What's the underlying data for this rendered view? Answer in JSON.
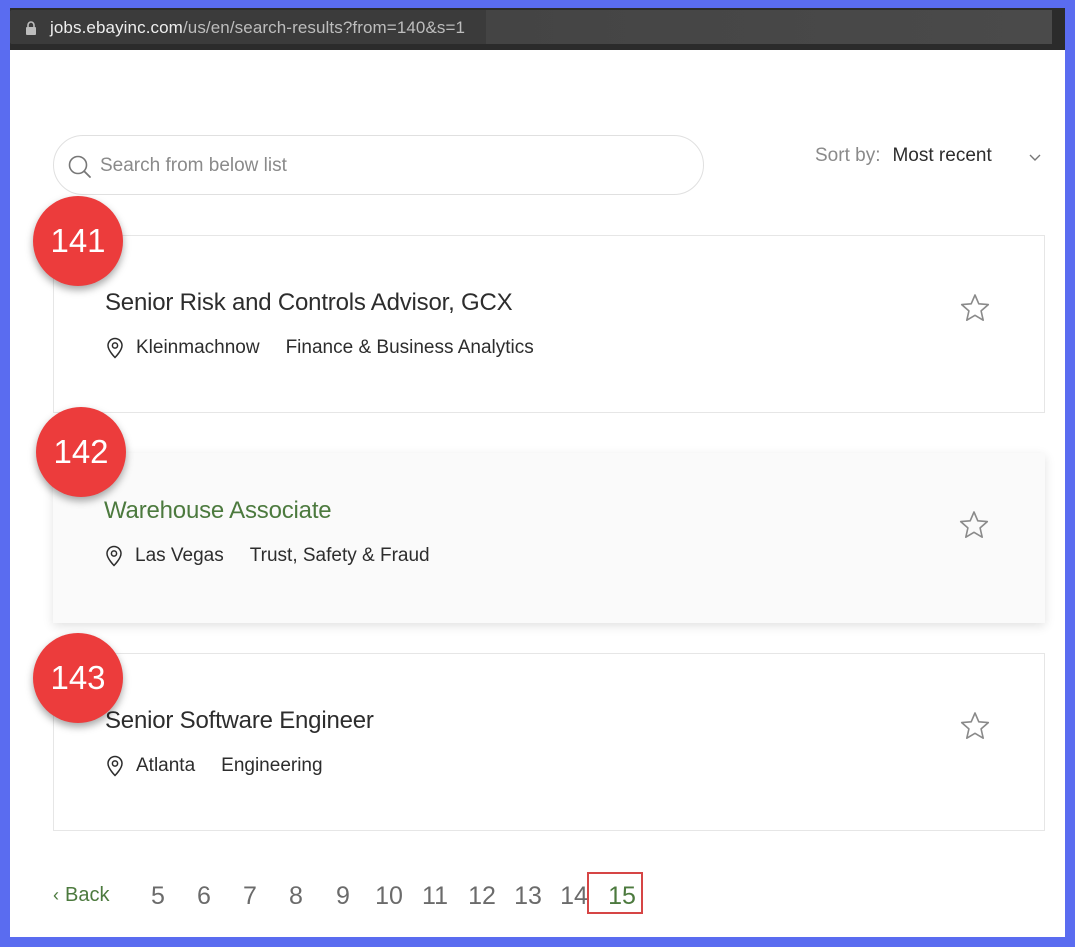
{
  "browser": {
    "url_host": "jobs.ebayinc.com",
    "url_path": "/us/en/search-results?from=140&s=1"
  },
  "search": {
    "placeholder": "Search from below list"
  },
  "sort": {
    "label": "Sort by:",
    "value": "Most recent"
  },
  "jobs": [
    {
      "badge": "141",
      "title": "Senior Risk and Controls Advisor, GCX",
      "location": "Kleinmachnow",
      "category": "Finance & Business Analytics"
    },
    {
      "badge": "142",
      "title": "Warehouse Associate",
      "location": "Las Vegas",
      "category": "Trust, Safety & Fraud"
    },
    {
      "badge": "143",
      "title": "Senior Software Engineer",
      "location": "Atlanta",
      "category": "Engineering"
    }
  ],
  "pagination": {
    "back_label": "Back",
    "pages": [
      "5",
      "6",
      "7",
      "8",
      "9",
      "10",
      "11",
      "12",
      "13",
      "14",
      "15"
    ],
    "current": "15"
  },
  "colors": {
    "accent_green": "#4c7a3e",
    "badge_red": "#ec3c3c",
    "frame_blue": "#5a6cf0",
    "highlight_red": "#d64545"
  }
}
